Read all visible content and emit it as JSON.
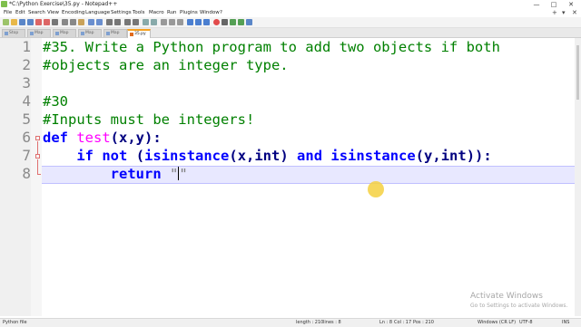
{
  "window": {
    "title": "*C:\\Python Exercise\\35.py - Notepad++",
    "controls": {
      "minimize": "—",
      "maximize": "□",
      "close": "✕"
    }
  },
  "menu": {
    "items": [
      "File",
      "Edit",
      "Search",
      "View",
      "Encoding",
      "Language",
      "Settings",
      "Tools",
      "Macro",
      "Run",
      "Plugins",
      "Window",
      "?"
    ],
    "right_plus": "+",
    "right_down": "▾",
    "right_close": "✕"
  },
  "tabs": [
    {
      "label": "Stop",
      "active": false
    },
    {
      "label": "Map",
      "active": false
    },
    {
      "label": "Map",
      "active": false
    },
    {
      "label": "Map",
      "active": false
    },
    {
      "label": "Map",
      "active": false
    },
    {
      "label": "35.py",
      "active": true
    }
  ],
  "editor": {
    "line_numbers": [
      "1",
      "2",
      "3",
      "4",
      "5",
      "6",
      "7",
      "8"
    ],
    "lines": {
      "l1": {
        "comment": "#35. Write a Python program to add two objects if both"
      },
      "l2": {
        "comment": "#objects are an integer type."
      },
      "l3": {},
      "l4": {
        "comment": "#30"
      },
      "l5": {
        "comment": "#Inputs must be integers!"
      },
      "l6": {
        "def": "def",
        "space": " ",
        "fname": "test",
        "rest": "(x,y):"
      },
      "l7": {
        "indent": "    ",
        "if": "if",
        "sp1": " ",
        "not": "not",
        "sp2": " ",
        "paren": "(",
        "isinst1": "isinstance",
        "args1": "(x,int)",
        "sp3": " ",
        "and": "and",
        "sp4": " ",
        "isinst2": "isinstance",
        "args2": "(y,int)",
        "end": "):"
      },
      "l8": {
        "indent": "        ",
        "return": "return",
        "sp": " ",
        "str_open": "\"",
        "str_close": "\""
      }
    }
  },
  "watermark": {
    "title": "Activate Windows",
    "subtitle": "Go to Settings to activate Windows."
  },
  "status": {
    "file_type": "Python file",
    "length": "length : 210",
    "lines": "lines : 8",
    "ln": "Ln : 8",
    "col": "Col : 17",
    "pos": "Pos : 210",
    "eol": "Windows (CR LF)",
    "encoding": "UTF-8",
    "mode": "INS"
  }
}
